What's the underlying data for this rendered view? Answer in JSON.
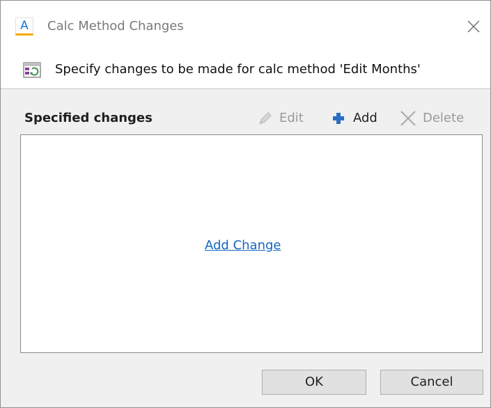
{
  "window": {
    "title": "Calc Method Changes",
    "app_icon_letter": "A",
    "close_icon": "close-icon"
  },
  "header": {
    "icon": "calc-method-icon",
    "description": "Specify changes to be made for calc method 'Edit Months'"
  },
  "changes": {
    "section_label": "Specified changes",
    "toolbar": {
      "edit": {
        "label": "Edit",
        "icon": "pencil-icon",
        "enabled": false
      },
      "add": {
        "label": "Add",
        "icon": "plus-icon",
        "enabled": true
      },
      "delete": {
        "label": "Delete",
        "icon": "x-icon",
        "enabled": false
      }
    },
    "empty_link": "Add Change"
  },
  "buttons": {
    "ok": "OK",
    "cancel": "Cancel"
  },
  "colors": {
    "link": "#1565c0",
    "add_icon": "#2b6cc4",
    "disabled_text": "#9a9a9a",
    "panel_background": "#f0f0f0"
  }
}
